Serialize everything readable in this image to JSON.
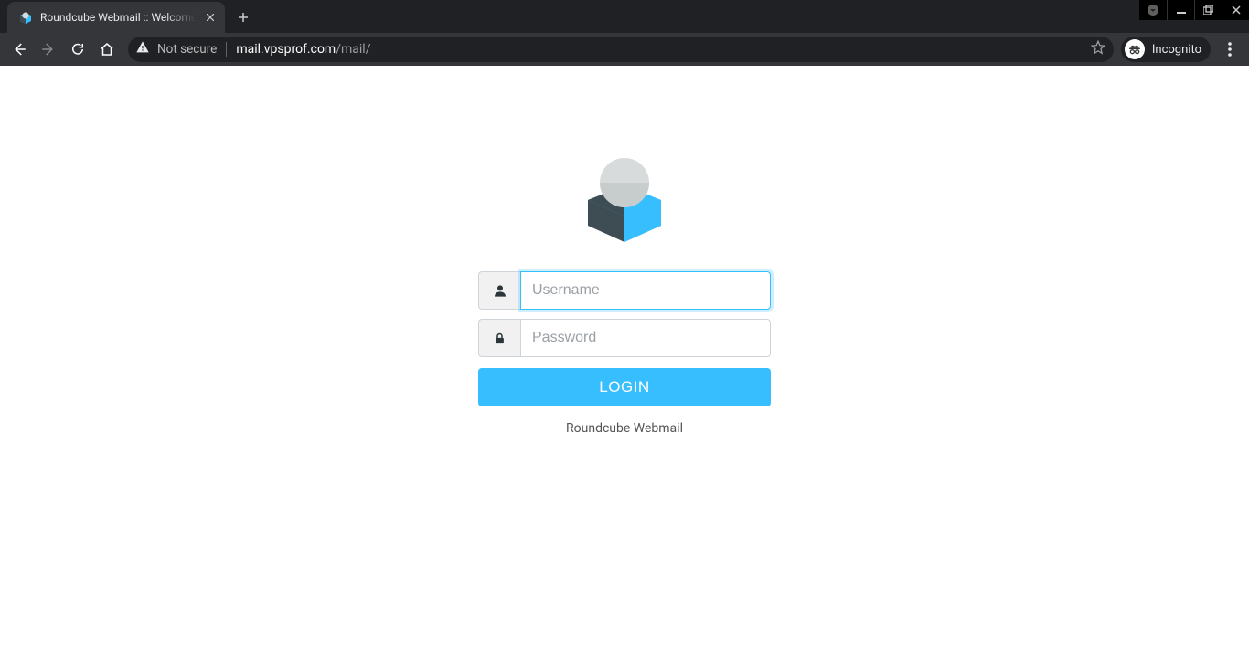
{
  "os": {
    "icons": {
      "minimize": "minimize",
      "maximize": "maximize",
      "close": "close",
      "indicator": "circle-down"
    }
  },
  "browser": {
    "tab_title": "Roundcube Webmail :: Welcome to Roundcube Webmail",
    "new_tab_label": "+",
    "security_label": "Not secure",
    "url_host": "mail.vpsprof.com",
    "url_path": "/mail/",
    "incognito_label": "Incognito"
  },
  "login": {
    "username_placeholder": "Username",
    "username_value": "",
    "password_placeholder": "Password",
    "password_value": "",
    "button_label": "LOGIN",
    "product_name": "Roundcube Webmail"
  },
  "colors": {
    "accent": "#37beff",
    "cube_dark": "#3e4d54",
    "cube_light": "#c9cdce"
  }
}
